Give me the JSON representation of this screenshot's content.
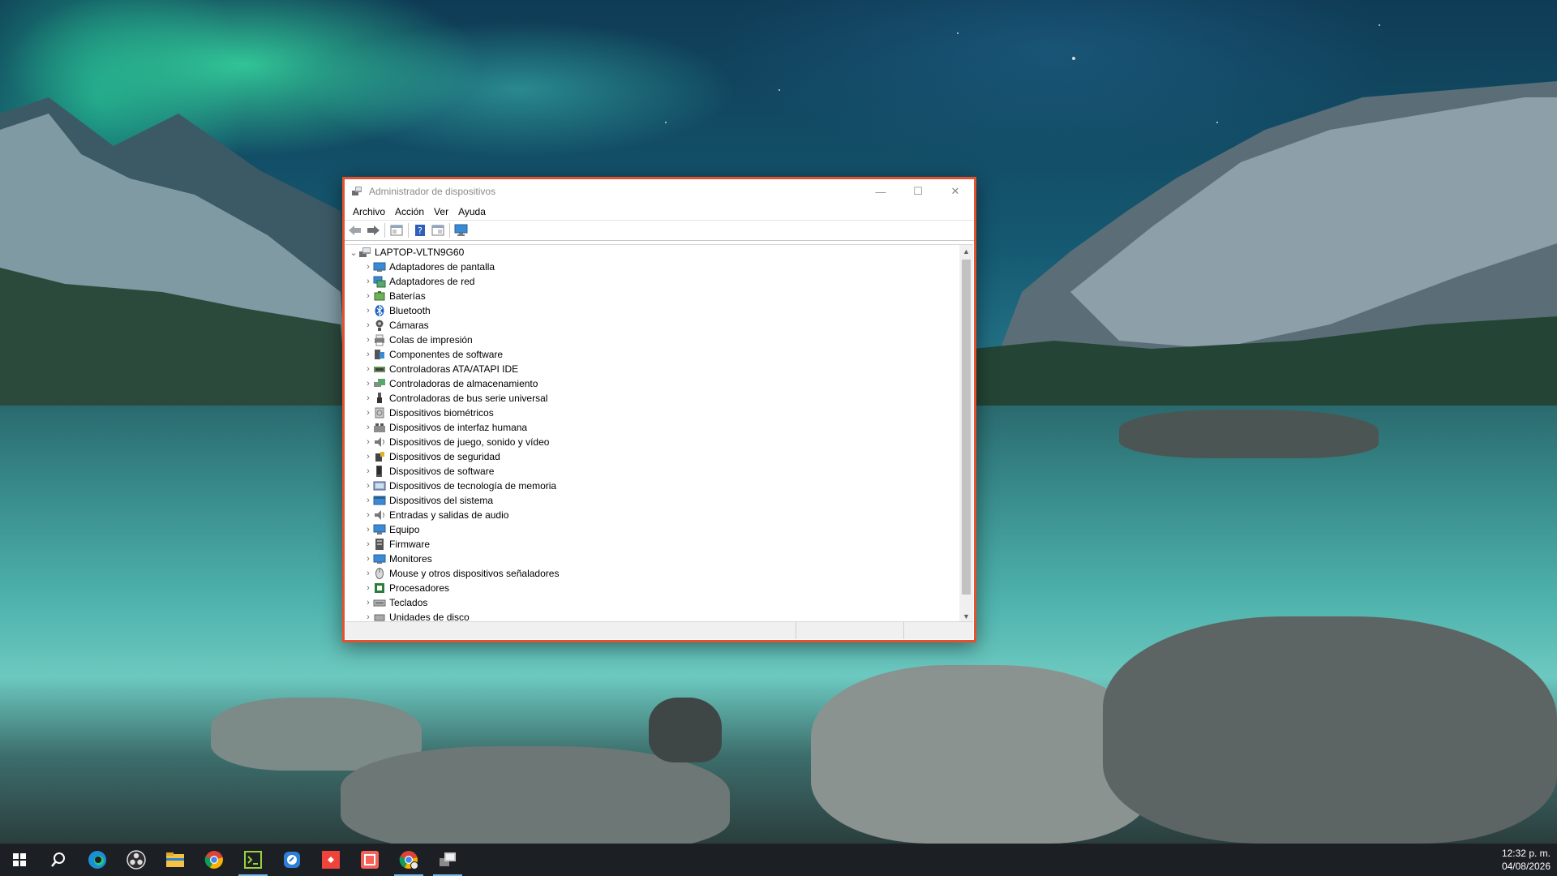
{
  "window": {
    "title": "Administrador de dispositivos",
    "controls": {
      "minimize": "—",
      "maximize": "☐",
      "close": "✕"
    }
  },
  "menu": [
    "Archivo",
    "Acción",
    "Ver",
    "Ayuda"
  ],
  "toolbar": {
    "buttons": [
      "back-icon",
      "forward-icon",
      "properties-icon",
      "help-icon",
      "view-icon",
      "scan-hardware-icon"
    ]
  },
  "tree": {
    "root": "LAPTOP-VLTN9G60",
    "categories": [
      "Adaptadores de pantalla",
      "Adaptadores de red",
      "Baterías",
      "Bluetooth",
      "Cámaras",
      "Colas de impresión",
      "Componentes de software",
      "Controladoras ATA/ATAPI IDE",
      "Controladoras de almacenamiento",
      "Controladoras de bus serie universal",
      "Dispositivos biométricos",
      "Dispositivos de interfaz humana",
      "Dispositivos de juego, sonido y vídeo",
      "Dispositivos de seguridad",
      "Dispositivos de software",
      "Dispositivos de tecnología de memoria",
      "Dispositivos del sistema",
      "Entradas y salidas de audio",
      "Equipo",
      "Firmware",
      "Monitores",
      "Mouse y otros dispositivos señaladores",
      "Procesadores",
      "Teclados",
      "Unidades de disco"
    ]
  },
  "taskbar": {
    "apps": [
      "windows-start-icon",
      "search-icon",
      "edge-icon",
      "obs-icon",
      "file-explorer-icon",
      "chrome-icon",
      "terminal-icon",
      "remote-desktop-icon",
      "anydesk-icon",
      "wps-pdf-icon",
      "chrome-profile-icon",
      "device-manager-icon"
    ],
    "time": "12:32 p. m.",
    "date": "04/08/2026"
  },
  "colors": {
    "window_highlight_border": "#e5502f",
    "taskbar_bg": "#1c1f24"
  }
}
